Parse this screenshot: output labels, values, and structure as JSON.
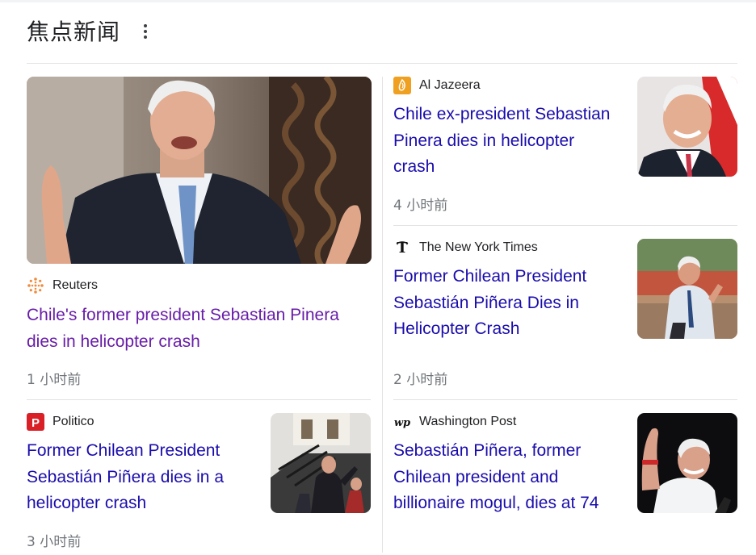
{
  "header": {
    "title": "焦点新闻"
  },
  "articles": [
    {
      "source": "Reuters",
      "headline": "Chile's former president Sebastian Pinera dies in helicopter crash",
      "time": "1 小时前"
    },
    {
      "source": "Al Jazeera",
      "headline": "Chile ex-president Sebastian Pinera dies in helicopter crash",
      "time": "4 小时前"
    },
    {
      "source": "The New York Times",
      "headline": "Former Chilean President Sebastián Piñera Dies in Helicopter Crash",
      "time": "2 小时前"
    },
    {
      "source": "Politico",
      "headline": "Former Chilean President Sebastián Piñera dies in a helicopter crash",
      "time": "3 小时前"
    },
    {
      "source": "Washington Post",
      "headline": "Sebastián Piñera, former Chilean president and billionaire mogul, dies at 74",
      "time": ""
    }
  ],
  "colors": {
    "link": "#1a0dab",
    "visited_link": "#681da8",
    "meta_text": "#70757a",
    "divider": "#e3e3e3",
    "aljazeera_brand": "#f0a020",
    "politico_brand": "#d92027",
    "reuters_brand": "#f08a3c"
  },
  "icons": {
    "reuters": "reuters-logo-icon",
    "aljazeera": "aljazeera-logo-icon",
    "nyt": "nyt-logo-icon",
    "politico": "politico-logo-icon",
    "wapo": "washington-post-logo-icon",
    "more": "more-vert-icon"
  }
}
